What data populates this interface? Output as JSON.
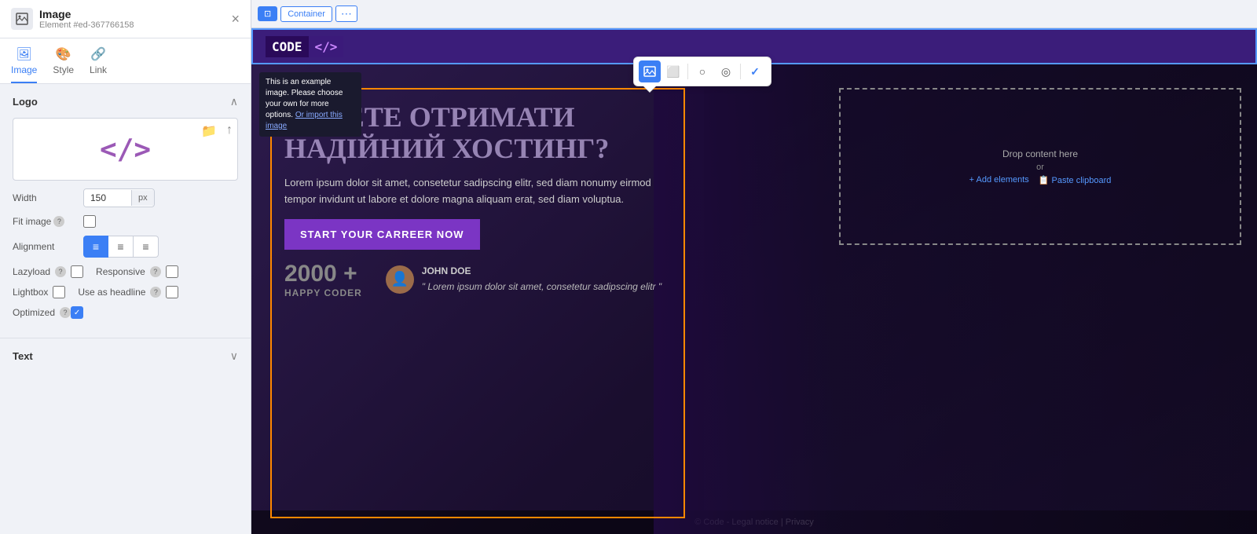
{
  "panel": {
    "title": "Image",
    "subtitle": "Element #ed-367766158",
    "close_label": "×",
    "tabs": [
      {
        "id": "image",
        "label": "Image",
        "icon": "🖼"
      },
      {
        "id": "style",
        "label": "Style",
        "icon": "🎨"
      },
      {
        "id": "link",
        "label": "Link",
        "icon": "🔗"
      }
    ],
    "logo_section": {
      "title": "Logo",
      "width_value": "150",
      "width_unit": "px",
      "fit_image_label": "Fit image",
      "alignment_label": "Alignment",
      "lazyload_label": "Lazyload",
      "responsive_label": "Responsive",
      "lightbox_label": "Lightbox",
      "use_as_headline_label": "Use as headline",
      "optimized_label": "Optimized"
    },
    "text_section": {
      "title": "Text"
    }
  },
  "topbar": {
    "container_label": "Container",
    "dots_label": "⋯"
  },
  "floating_toolbar": {
    "image_icon": "🖼",
    "crop_icon": "⬜",
    "circle_icon": "○",
    "target_icon": "◎",
    "check_icon": "✓"
  },
  "site": {
    "logo_text": "CODE",
    "logo_symbol": "</>",
    "nav_height": 46,
    "hero_title": "ХОЧЕТЕ ОТРИМАТИ НАДІЙНИЙ ХОСТИНГ?",
    "hero_desc": "Lorem ipsum dolor sit amet, consetetur sadipscing elitr, sed diam nonumy eirmod tempor invidunt ut labore et dolore magna aliquam erat, sed diam voluptua.",
    "hero_btn": "START YOUR CARREER NOW",
    "stats_number": "2000 +",
    "stats_label": "HAPPY CODER",
    "testimonial_name": "JOHN DOE",
    "testimonial_quote": "\" Lorem ipsum dolor sit amet, consetetur sadipscing elitr \"",
    "drop_content_text": "Drop content here",
    "drop_or": "or",
    "drop_add": "+ Add elements",
    "drop_paste": "📋 Paste clipboard",
    "tooltip_text": "This is an example image. Please choose your own for more options.",
    "tooltip_link": "Or import this image",
    "footer_text": "© Code - Legal notice | Privacy"
  }
}
